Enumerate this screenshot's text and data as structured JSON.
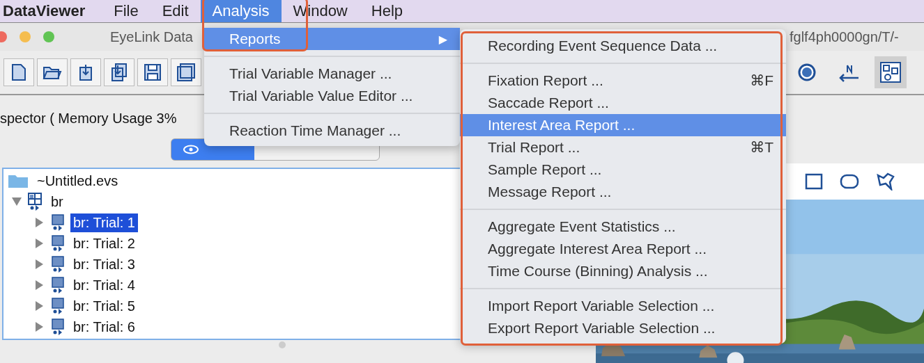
{
  "menu_bar": {
    "items": [
      {
        "label": "DataViewer",
        "kind": "app",
        "selected": false
      },
      {
        "label": "File",
        "kind": "menu",
        "selected": false
      },
      {
        "label": "Edit",
        "kind": "menu",
        "selected": false
      },
      {
        "label": "Analysis",
        "kind": "menu",
        "selected": true
      },
      {
        "label": "Window",
        "kind": "menu",
        "selected": false
      },
      {
        "label": "Help",
        "kind": "menu",
        "selected": false
      }
    ]
  },
  "window": {
    "title": "EyeLink Data",
    "title_tail": "fglf4ph0000gn/T/-"
  },
  "toolbar": {
    "left_tools": [
      {
        "kind": "new",
        "selected": false
      },
      {
        "kind": "open",
        "selected": false
      },
      {
        "kind": "import",
        "selected": false
      },
      {
        "kind": "import-multi",
        "selected": false
      },
      {
        "kind": "save",
        "selected": false
      },
      {
        "kind": "save-as",
        "selected": false
      }
    ],
    "right_tools": [
      {
        "kind": "target",
        "selected": false
      },
      {
        "kind": "import-in",
        "selected": false
      },
      {
        "kind": "layout",
        "selected": true
      }
    ]
  },
  "inspector": {
    "label": "spector ( Memory Usage 3%",
    "view_tab": {
      "selected": true
    }
  },
  "tree": {
    "label": "~Untitled.evs",
    "children": [
      {
        "label": "br",
        "expanded": true,
        "children": [
          {
            "label": "br: Trial: 1",
            "selected": true,
            "expanded": false
          },
          {
            "label": "br: Trial: 2",
            "selected": false,
            "expanded": false
          },
          {
            "label": "br: Trial: 3",
            "selected": false,
            "expanded": false
          },
          {
            "label": "br: Trial: 4",
            "selected": false,
            "expanded": false
          },
          {
            "label": "br: Trial: 5",
            "selected": false,
            "expanded": false
          },
          {
            "label": "br: Trial: 6",
            "selected": false,
            "expanded": false
          }
        ]
      }
    ]
  },
  "shape_tools": [
    {
      "kind": "rectangle"
    },
    {
      "kind": "ellipse"
    },
    {
      "kind": "freehand"
    }
  ],
  "analysis_menu": {
    "framed": true,
    "groups": [
      {
        "items": [
          {
            "label": "Reports",
            "selected": true,
            "submenu_arrow": "▶"
          }
        ]
      },
      {
        "items": [
          {
            "label": "Trial Variable Manager ...",
            "selected": false
          },
          {
            "label": "Trial Variable Value Editor ...",
            "selected": false
          }
        ]
      },
      {
        "items": [
          {
            "label": "Reaction Time Manager ...",
            "selected": false
          }
        ]
      }
    ]
  },
  "reports_submenu": {
    "framed": true,
    "groups": [
      {
        "items": [
          {
            "label": "Recording Event Sequence Data ...",
            "selected": false
          }
        ]
      },
      {
        "items": [
          {
            "label": "Fixation Report ...",
            "shortcut": "⌘F",
            "selected": false
          },
          {
            "label": "Saccade Report ...",
            "selected": false
          },
          {
            "label": "Interest Area Report ...",
            "selected": true
          },
          {
            "label": "Trial Report ...",
            "shortcut": "⌘T",
            "selected": false
          },
          {
            "label": "Sample Report ...",
            "selected": false
          },
          {
            "label": "Message Report ...",
            "selected": false
          }
        ]
      },
      {
        "items": [
          {
            "label": "Aggregate Event Statistics ...",
            "selected": false
          },
          {
            "label": "Aggregate Interest Area Report ...",
            "selected": false
          },
          {
            "label": "Time Course (Binning) Analysis ...",
            "selected": false
          }
        ]
      },
      {
        "items": [
          {
            "label": "Import Report Variable Selection ...",
            "selected": false
          },
          {
            "label": "Export Report Variable Selection ...",
            "selected": false
          }
        ]
      }
    ]
  }
}
